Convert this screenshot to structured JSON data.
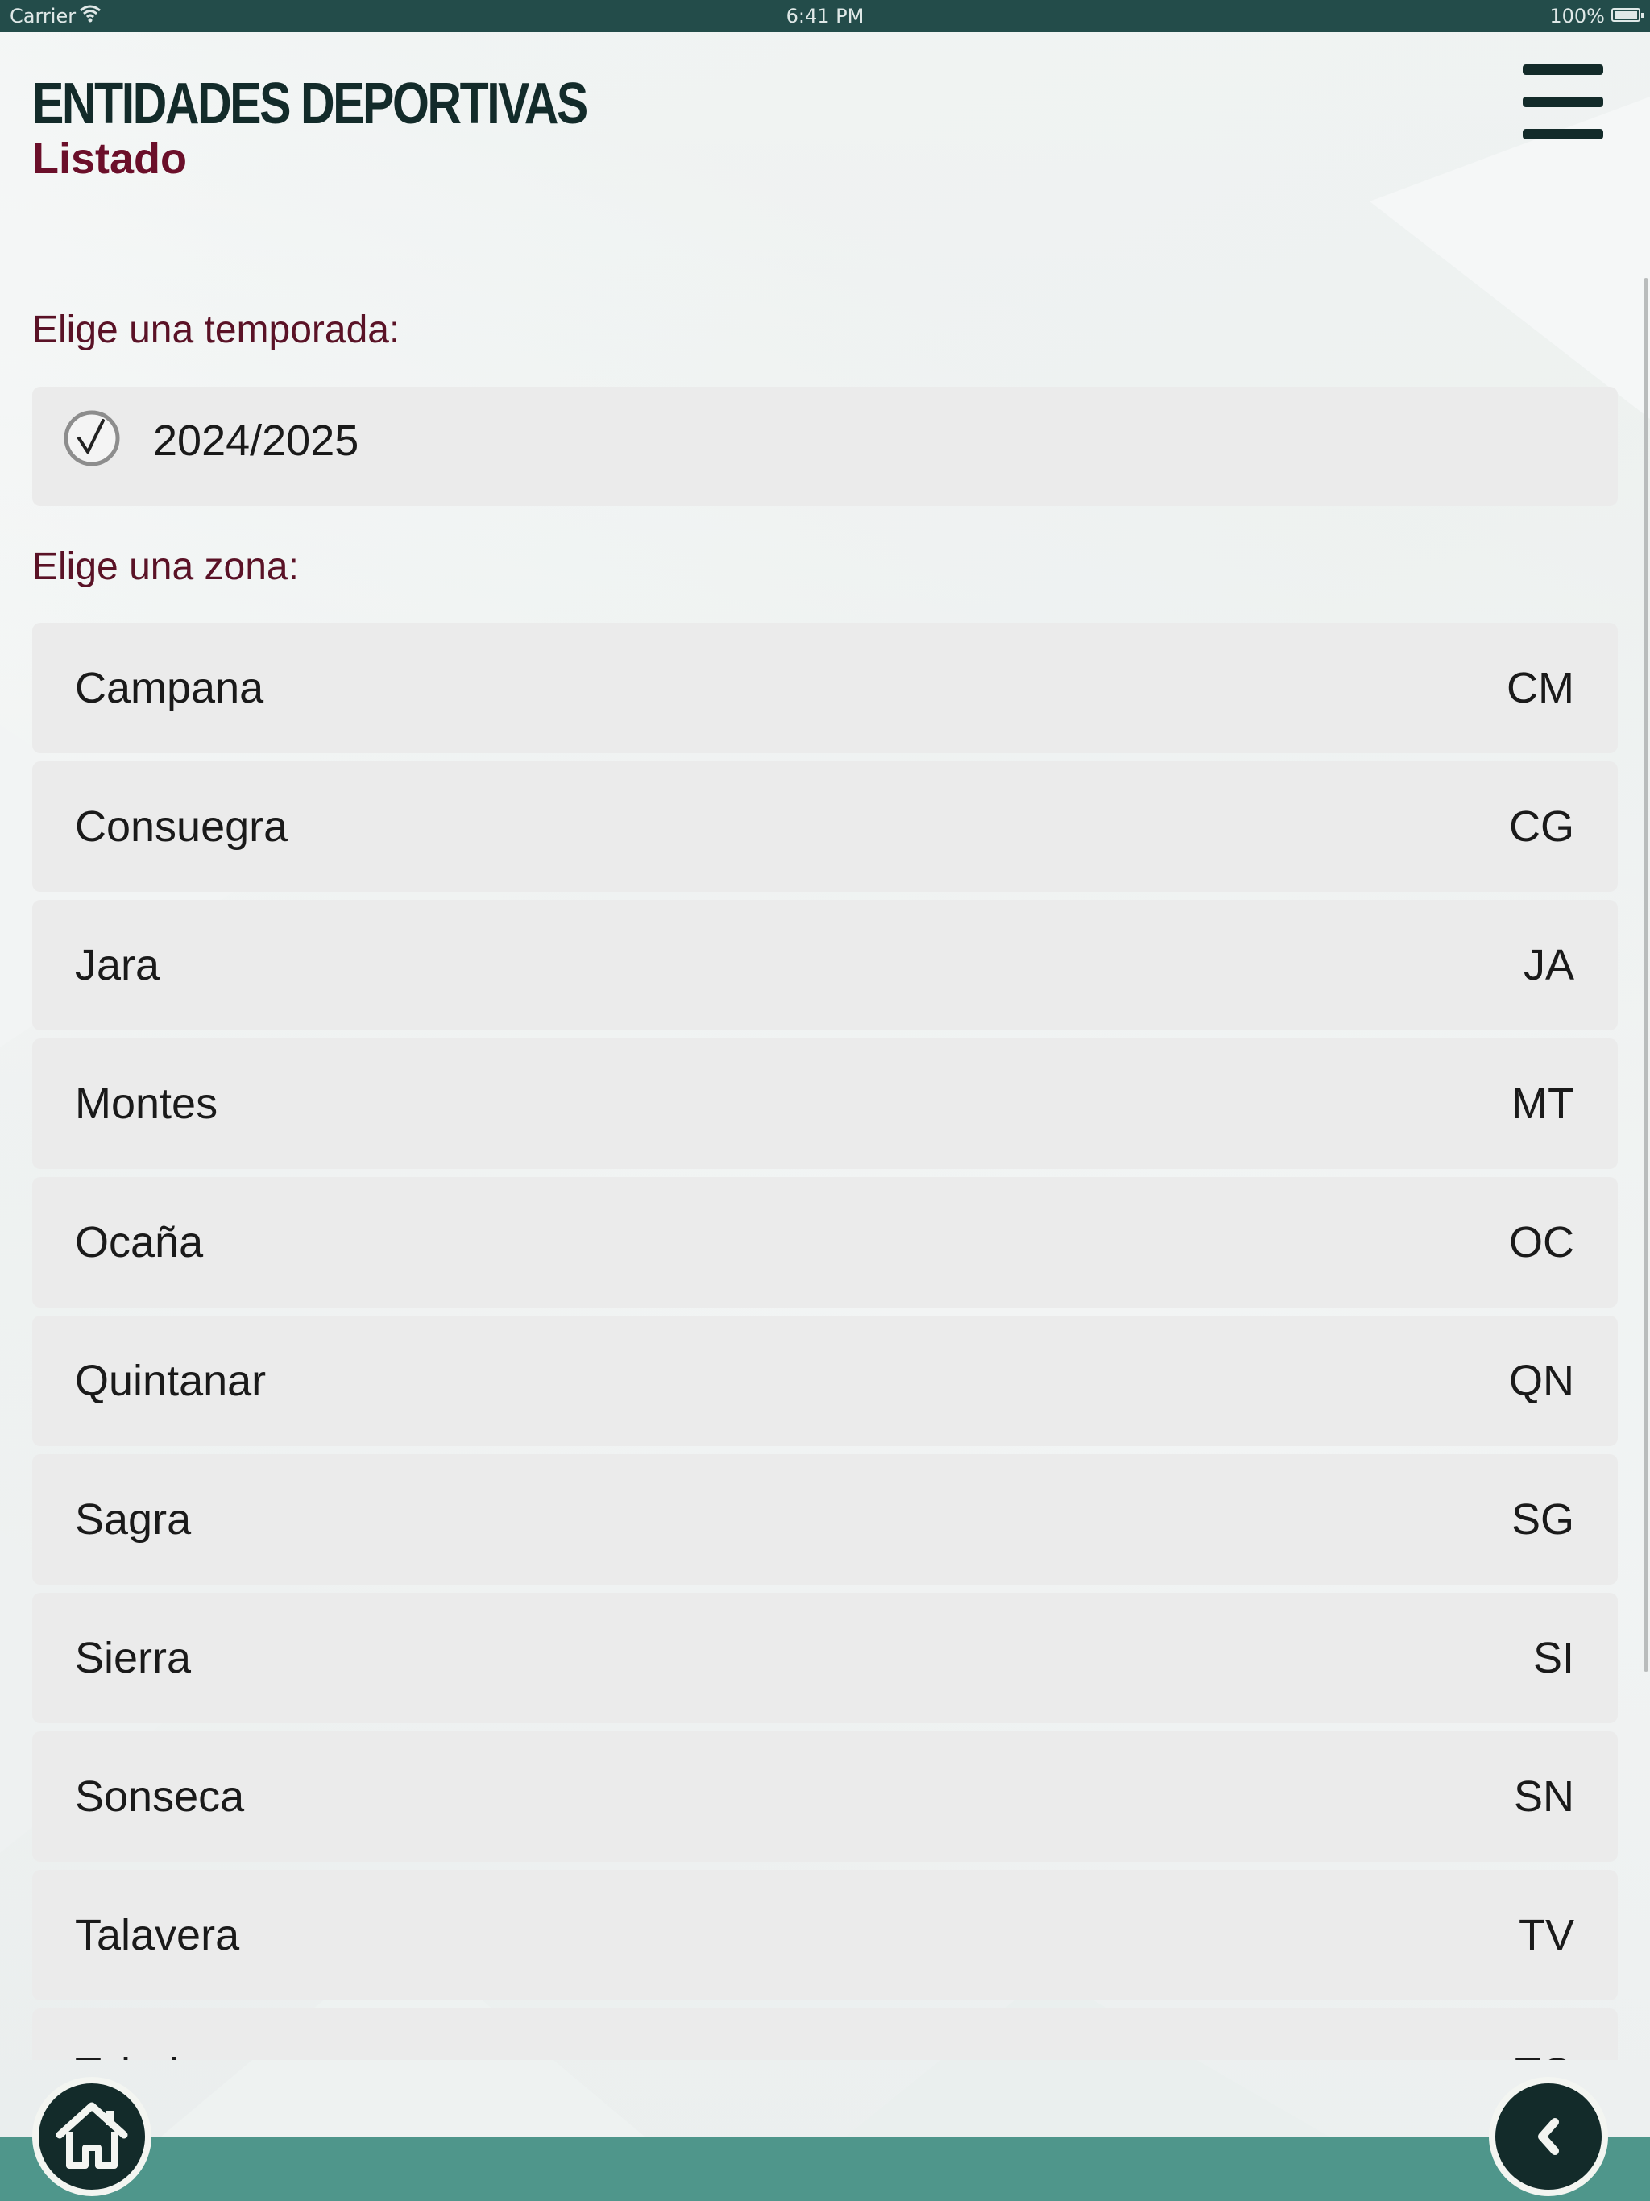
{
  "status_bar": {
    "carrier": "Carrier",
    "time": "6:41 PM",
    "battery": "100%"
  },
  "header": {
    "title": "ENTIDADES DEPORTIVAS",
    "subtitle": "Listado",
    "menu_icon": "hamburger-menu-icon"
  },
  "season": {
    "label": "Elige una temporada:",
    "selected": "2024/2025",
    "icon": "check-circle-icon"
  },
  "zones": {
    "label": "Elige una zona:",
    "items": [
      {
        "name": "Campana",
        "code": "CM"
      },
      {
        "name": "Consuegra",
        "code": "CG"
      },
      {
        "name": "Jara",
        "code": "JA"
      },
      {
        "name": "Montes",
        "code": "MT"
      },
      {
        "name": "Ocaña",
        "code": "OC"
      },
      {
        "name": "Quintanar",
        "code": "QN"
      },
      {
        "name": "Sagra",
        "code": "SG"
      },
      {
        "name": "Sierra",
        "code": "SI"
      },
      {
        "name": "Sonseca",
        "code": "SN"
      },
      {
        "name": "Talavera",
        "code": "TV"
      },
      {
        "name": "Toledo",
        "code": "TO"
      }
    ]
  },
  "footer": {
    "home_icon": "home-icon",
    "back_icon": "chevron-left-icon"
  },
  "colors": {
    "dark": "#132b2a",
    "accent": "#6b0f2a",
    "status_bar": "#234c4a",
    "bottom_bar": "#4f968b",
    "row": "#ebebeb"
  }
}
